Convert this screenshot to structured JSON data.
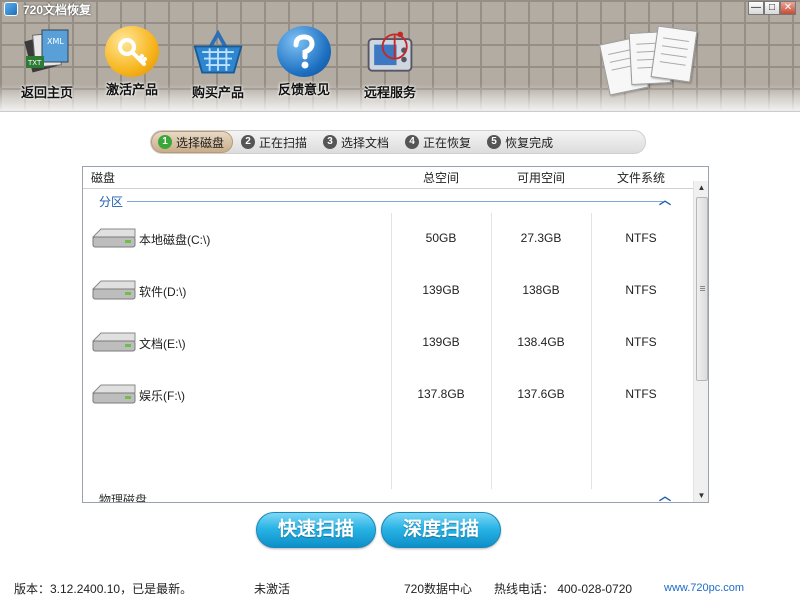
{
  "window": {
    "title": "720文档恢复"
  },
  "toolbar": {
    "items": [
      {
        "label": "返回主页",
        "icon": "documents-icon"
      },
      {
        "label": "激活产品",
        "icon": "key-icon"
      },
      {
        "label": "购买产品",
        "icon": "basket-icon"
      },
      {
        "label": "反馈意见",
        "icon": "help-icon"
      },
      {
        "label": "远程服务",
        "icon": "remote-service-icon"
      }
    ]
  },
  "steps": [
    {
      "num": "1",
      "label": "选择磁盘"
    },
    {
      "num": "2",
      "label": "正在扫描"
    },
    {
      "num": "3",
      "label": "选择文档"
    },
    {
      "num": "4",
      "label": "正在恢复"
    },
    {
      "num": "5",
      "label": "恢复完成"
    }
  ],
  "table": {
    "headers": {
      "disk": "磁盘",
      "total": "总空间",
      "free": "可用空间",
      "fs": "文件系统"
    },
    "group_partitions": "分区",
    "rows": [
      {
        "name": "本地磁盘(C:\\)",
        "total": "50GB",
        "free": "27.3GB",
        "fs": "NTFS"
      },
      {
        "name": "软件(D:\\)",
        "total": "139GB",
        "free": "138GB",
        "fs": "NTFS"
      },
      {
        "name": "文档(E:\\)",
        "total": "139GB",
        "free": "138.4GB",
        "fs": "NTFS"
      },
      {
        "name": "娱乐(F:\\)",
        "total": "137.8GB",
        "free": "137.6GB",
        "fs": "NTFS"
      }
    ],
    "group_physical": "物理磁盘"
  },
  "buttons": {
    "quick_scan": "快速扫描",
    "deep_scan": "深度扫描"
  },
  "statusbar": {
    "version": "版本：3.12.2400.10，已是最新。",
    "activation": "未激活",
    "data_center": "720数据中心",
    "hotline": "热线电话： 400-028-0720",
    "website": "www.720pc.com"
  },
  "colors": {
    "accent": "#1e5eb0",
    "button": "#2ab4e6",
    "step_active": "#39a838"
  }
}
